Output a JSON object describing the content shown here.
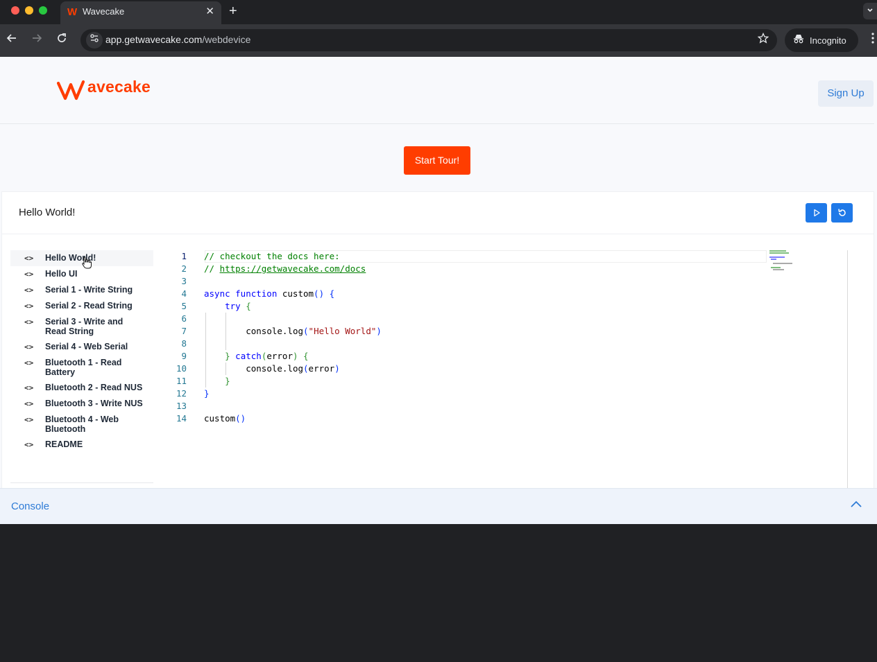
{
  "browser": {
    "tab_title": "Wavecake",
    "tab_favicon": "W",
    "tab_close": "✕",
    "new_tab": "+",
    "url_domain": "app.getwavecake.com",
    "url_path": "/webdevice",
    "incognito_label": "Incognito"
  },
  "header": {
    "logo_text": "avecake",
    "signup_label": "Sign Up"
  },
  "tour_button": "Start Tour!",
  "panel": {
    "title": "Hello World!",
    "run_icon": "play-icon",
    "reset_icon": "refresh-icon"
  },
  "sidebar": {
    "icon_glyph": "<>",
    "items": [
      {
        "label": "Hello World!"
      },
      {
        "label": "Hello UI"
      },
      {
        "label": "Serial 1 - Write String"
      },
      {
        "label": "Serial 2 - Read String"
      },
      {
        "label": "Serial 3 - Write and Read String"
      },
      {
        "label": "Serial 4 - Web Serial"
      },
      {
        "label": "Bluetooth 1 - Read Battery"
      },
      {
        "label": "Bluetooth 2 - Read NUS"
      },
      {
        "label": "Bluetooth 3 - Write NUS"
      },
      {
        "label": "Bluetooth 4 - Web Bluetooth"
      },
      {
        "label": "README"
      }
    ]
  },
  "editor": {
    "line_numbers": [
      "1",
      "2",
      "3",
      "4",
      "5",
      "6",
      "7",
      "8",
      "9",
      "10",
      "11",
      "12",
      "13",
      "14"
    ],
    "lines": {
      "l1": "// checkout the docs here:",
      "l2_prefix": "// ",
      "l2_link": "https://getwavecake.com/docs",
      "l4_kw": "async function",
      "l4_name": " custom",
      "l4_paren": "()",
      "l4_brace": " {",
      "l5_kw": "try",
      "l5_brace": " {",
      "l7_call": "console.log",
      "l7_open": "(",
      "l7_str": "\"Hello World\"",
      "l7_close": ")",
      "l9_brace": "} ",
      "l9_kw": "catch",
      "l9_open": "(",
      "l9_arg": "error",
      "l9_close": ")",
      "l9_brace2": " {",
      "l10_call": "console.log",
      "l10_open": "(",
      "l10_arg": "error",
      "l10_close": ")",
      "l11_brace": "}",
      "l12_brace": "}",
      "l14_call": "custom",
      "l14_paren": "()"
    }
  },
  "console": {
    "label": "Console"
  },
  "colors": {
    "brand": "#ff3d00",
    "accent_blue": "#1f79e8",
    "link_blue": "#2e7bd6"
  }
}
